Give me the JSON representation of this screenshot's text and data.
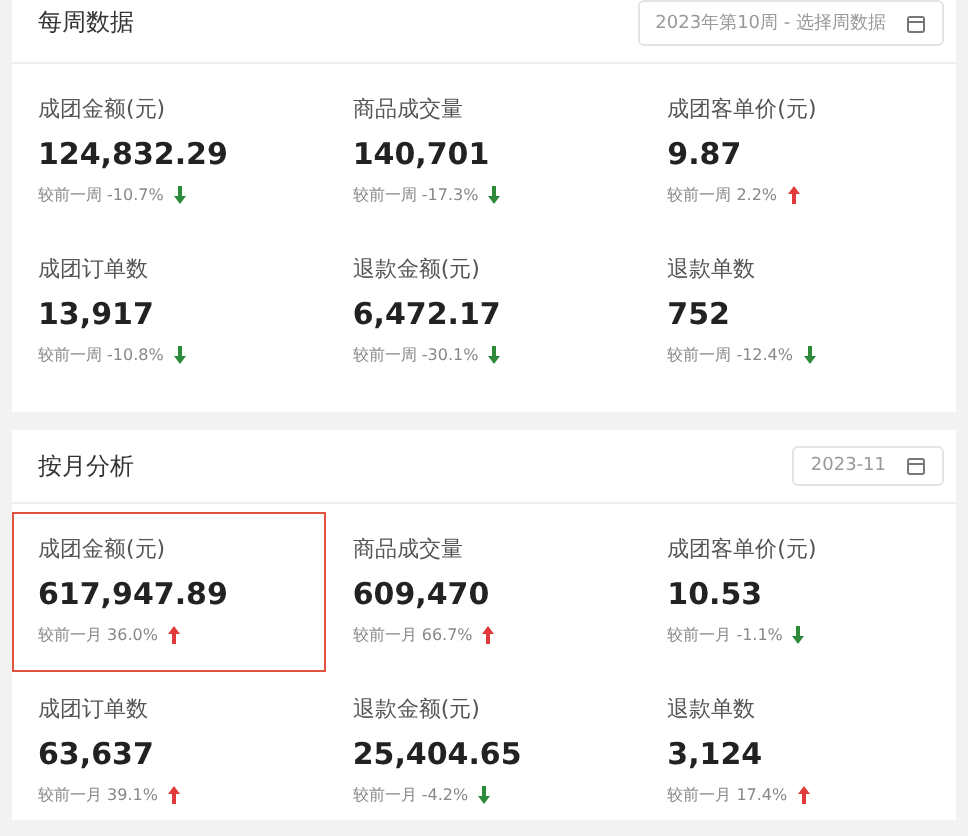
{
  "sections": [
    {
      "title": "每周数据",
      "picker": {
        "text": "2023年第10周 - 选择周数据"
      },
      "metrics": [
        {
          "label": "成团金额(元)",
          "value": "124,832.29",
          "compare": "较前一周 -10.7%",
          "rising": false,
          "highlighted": false
        },
        {
          "label": "商品成交量",
          "value": "140,701",
          "compare": "较前一周 -17.3%",
          "rising": false,
          "highlighted": false
        },
        {
          "label": "成团客单价(元)",
          "value": "9.87",
          "compare": "较前一周 2.2%",
          "rising": true,
          "highlighted": false
        },
        {
          "label": "成团订单数",
          "value": "13,917",
          "compare": "较前一周 -10.8%",
          "rising": false,
          "highlighted": false
        },
        {
          "label": "退款金额(元)",
          "value": "6,472.17",
          "compare": "较前一周 -30.1%",
          "rising": false,
          "highlighted": false
        },
        {
          "label": "退款单数",
          "value": "752",
          "compare": "较前一周 -12.4%",
          "rising": false,
          "highlighted": false
        }
      ]
    },
    {
      "title": "按月分析",
      "picker": {
        "text": "2023-11"
      },
      "metrics": [
        {
          "label": "成团金额(元)",
          "value": "617,947.89",
          "compare": "较前一月 36.0%",
          "rising": true,
          "highlighted": true
        },
        {
          "label": "商品成交量",
          "value": "609,470",
          "compare": "较前一月 66.7%",
          "rising": true,
          "highlighted": false
        },
        {
          "label": "成团客单价(元)",
          "value": "10.53",
          "compare": "较前一月 -1.1%",
          "rising": false,
          "highlighted": false
        },
        {
          "label": "成团订单数",
          "value": "63,637",
          "compare": "较前一月 39.1%",
          "rising": true,
          "highlighted": false
        },
        {
          "label": "退款金额(元)",
          "value": "25,404.65",
          "compare": "较前一月 -4.2%",
          "rising": false,
          "highlighted": false
        },
        {
          "label": "退款单数",
          "value": "3,124",
          "compare": "较前一月 17.4%",
          "rising": true,
          "highlighted": false
        }
      ]
    }
  ]
}
